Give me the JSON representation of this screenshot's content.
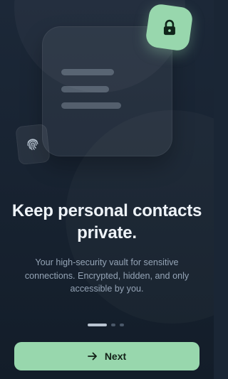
{
  "onboarding": {
    "title": "Keep personal contacts private.",
    "subtitle": "Your high-security vault for sensitive connections. Encrypted, hidden, and only accessible by you.",
    "current_page": 1,
    "total_pages": 3,
    "next_label": "Next"
  },
  "icons": {
    "illustration": "document-card",
    "badge_top": "lock-icon",
    "badge_left": "fingerprint-icon",
    "button": "arrow-right-icon"
  },
  "colors": {
    "background": "#1a2635",
    "accent": "#98d7ad",
    "title": "#eef3f8",
    "subtitle": "#95a4b6"
  }
}
